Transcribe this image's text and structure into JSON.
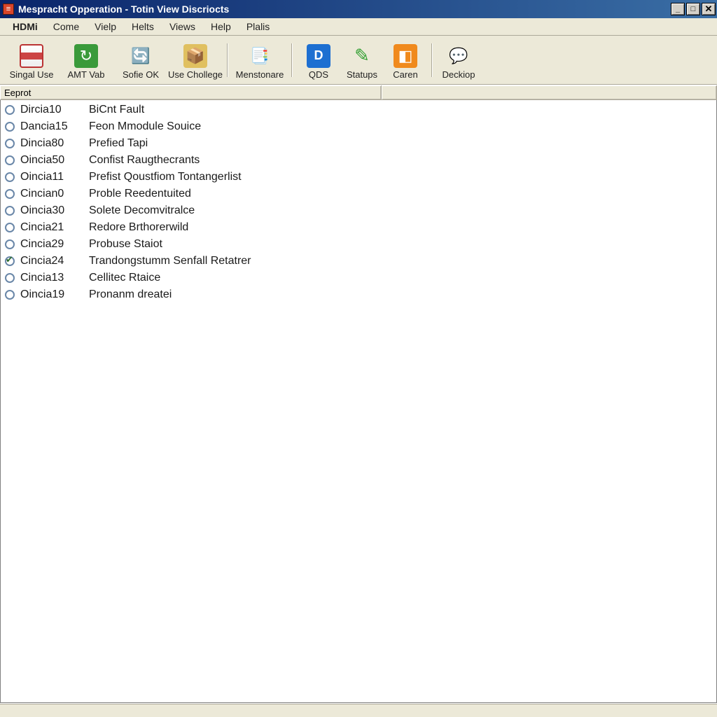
{
  "window": {
    "title": "Mespracht Opperation - Totin View Discriocts"
  },
  "menubar": {
    "items": [
      "HDMi",
      "Come",
      "Vielp",
      "Helts",
      "Views",
      "Help",
      "Plalis"
    ]
  },
  "toolbar": {
    "groups": [
      [
        {
          "name": "singal-use",
          "label": "Singal Use",
          "icon": "ico-singal"
        },
        {
          "name": "amt-vab",
          "label": "AMT Vab",
          "icon": "ico-amt"
        },
        {
          "name": "sofie-ok",
          "label": "Sofie OK",
          "icon": "ico-sofie"
        },
        {
          "name": "use-chollege",
          "label": "Use Chollege",
          "icon": "ico-chol"
        }
      ],
      [
        {
          "name": "menstonare",
          "label": "Menstonare",
          "icon": "ico-mens"
        }
      ],
      [
        {
          "name": "qds",
          "label": "QDS",
          "icon": "ico-qds",
          "narrow": true
        },
        {
          "name": "statups",
          "label": "Statups",
          "icon": "ico-stat",
          "narrow": true
        },
        {
          "name": "caren",
          "label": "Caren",
          "icon": "ico-caren",
          "narrow": true
        }
      ],
      [
        {
          "name": "deckiop",
          "label": "Deckiop",
          "icon": "ico-desk",
          "narrow": true
        }
      ]
    ]
  },
  "columns": {
    "c1": "Eeprot",
    "c2": ""
  },
  "list": {
    "items": [
      {
        "code": "Dircia10",
        "desc": "BiCnt Fault",
        "checked": false
      },
      {
        "code": "Dancia15",
        "desc": "Feon Mmodule Souice",
        "checked": false
      },
      {
        "code": "Dincia80",
        "desc": "Prefied Tapi",
        "checked": false
      },
      {
        "code": "Oincia50",
        "desc": "Confist Raugthecrants",
        "checked": false
      },
      {
        "code": "Oincia11",
        "desc": "Prefist Qoustfiom Tontangerlist",
        "checked": false
      },
      {
        "code": "Cincian0",
        "desc": "Proble Reedentuited",
        "checked": false
      },
      {
        "code": "Oincia30",
        "desc": "Solete Decomvitralce",
        "checked": false
      },
      {
        "code": "Cincia21",
        "desc": "Redore Brthorerwild",
        "checked": false
      },
      {
        "code": "Cincia29",
        "desc": "Probuse Staiot",
        "checked": false
      },
      {
        "code": "Cincia24",
        "desc": "Trandongstumm Senfall Retatrer",
        "checked": true
      },
      {
        "code": "Cincia13",
        "desc": "Cellitec Rtaice",
        "checked": false
      },
      {
        "code": "Oincia19",
        "desc": "Pronanm dreatei",
        "checked": false
      }
    ]
  }
}
